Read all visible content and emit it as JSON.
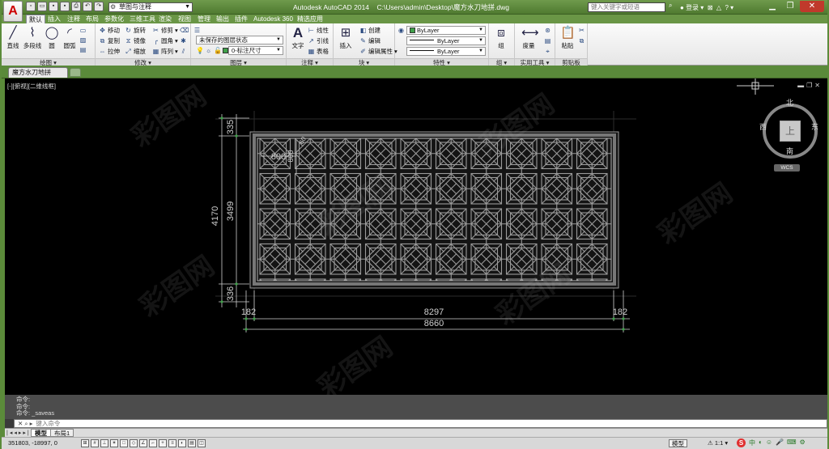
{
  "title_bar": {
    "app_title": "Autodesk AutoCAD 2014",
    "file_path": "C:\\Users\\admin\\Desktop\\魔方水刀地拼.dwg",
    "workspace": "草图与注释",
    "search_placeholder": "键入关键字或短语",
    "sign_in": "登录",
    "logo_letter": "A"
  },
  "menu_tabs": [
    "默认",
    "插入",
    "注释",
    "布局",
    "参数化",
    "三维工具",
    "渲染",
    "视图",
    "管理",
    "输出",
    "插件",
    "Autodesk 360",
    "精选应用"
  ],
  "ribbon": {
    "draw": {
      "title": "绘图 ▾",
      "line": "直线",
      "polyline": "多段线",
      "circle": "圆",
      "arc": "圆弧"
    },
    "modify": {
      "title": "修改 ▾",
      "move": "移动",
      "rotate": "旋转",
      "trim": "修剪",
      "copy": "复制",
      "mirror": "镜像",
      "fillet": "圆角",
      "stretch": "拉伸",
      "scale": "缩放",
      "array": "阵列"
    },
    "layers": {
      "title": "图层 ▾",
      "layer_state": "未保存的图层状态",
      "current_layer": "0-标注尺寸"
    },
    "annotation": {
      "title": "注释 ▾",
      "text": "文字",
      "linear": "线性",
      "leader": "引线",
      "table": "表格"
    },
    "block": {
      "title": "块 ▾",
      "insert": "插入",
      "create": "创建",
      "edit": "编辑",
      "edit_attributes": "编辑属性"
    },
    "properties": {
      "title": "特性 ▾",
      "color": "ByLayer",
      "linetype": "ByLayer",
      "lineweight": "ByLayer"
    },
    "groups": {
      "title": "组 ▾",
      "group": "组"
    },
    "utilities": {
      "title": "实用工具 ▾",
      "measure": "度量"
    },
    "clipboard": {
      "title": "剪贴板",
      "paste": "粘贴"
    }
  },
  "document_tab": "魔方水刀地拼",
  "viewport": {
    "label": "[-][俯视][二维线框]",
    "viewcube": {
      "north": "北",
      "south": "南",
      "east": "东",
      "west": "西",
      "face": "上",
      "wcs": "WCS"
    }
  },
  "drawing": {
    "dim_total_height": "4170",
    "dim_inner_height": "3499",
    "dim_top_border": "335",
    "dim_bottom_border": "336",
    "dim_left_border": "182",
    "dim_inner_width": "8297",
    "dim_right_border": "182",
    "dim_total_width": "8660",
    "dim_tile_width": "800",
    "dim_tile_height": "800",
    "dim_small": "60"
  },
  "command": {
    "history": [
      "命令:",
      "命令:",
      "命令: _saveas"
    ],
    "input_placeholder": "键入命令"
  },
  "layout_tabs": [
    "模型",
    "布局1"
  ],
  "status_bar": {
    "coordinates": "351803, -18997, 0",
    "model": "模型",
    "scale": "1:1",
    "ime": "中"
  },
  "watermark_text": "彩图网"
}
